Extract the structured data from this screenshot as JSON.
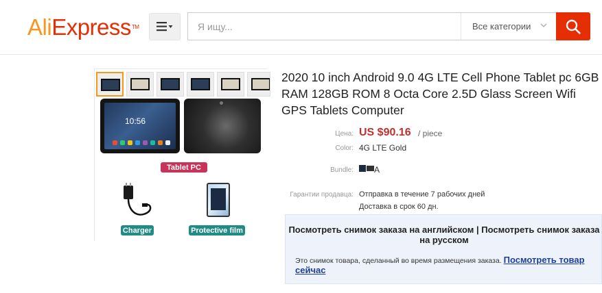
{
  "header": {
    "logo_text_ali": "Ali",
    "logo_text_express": "Express",
    "logo_tm": "TM",
    "menu_icon": "menu-icon",
    "search": {
      "placeholder": "Я ищу...",
      "value": ""
    },
    "category_label": "Все категории",
    "search_icon": "search-icon"
  },
  "gallery": {
    "main_labels": {
      "tablet": "Tablet PC",
      "charger": "Charger",
      "film": "Protective film"
    },
    "clock": "10:56"
  },
  "product": {
    "title": "2020 10 inch Android 9.0 4G LTE Cell Phone Tablet pc 6GB RAM 128GB ROM 8 Octa Core 2.5D Glass Screen Wifi GPS Tablets Computer",
    "price_label": "Цена:",
    "price": "US $90.16",
    "price_unit": "/ piece",
    "color_label": "Color:",
    "color_value": "4G LTE Gold",
    "bundle_label": "Bundle:",
    "bundle_value": "A",
    "guarantee_label": "Гарантии продавца:",
    "guarantee_ship": "Отправка в течение 7 рабочих дней",
    "guarantee_delivery": "Доставка в срок 60 дн."
  },
  "snapshot": {
    "view_english": "Посмотреть снимок заказа на английском",
    "separator": "|",
    "view_russian": "Посмотреть снимок заказа на русском",
    "note": "Это снимок товара, сделанный во время размещения заказа.",
    "view_now": "Посмотреть товар сейчас"
  },
  "colors": {
    "brand_red": "#e62e04",
    "brand_orange": "#f7971d",
    "price_red": "#c03030",
    "link_blue": "#1c3f9a",
    "snapshot_bg": "#eef3fb"
  }
}
